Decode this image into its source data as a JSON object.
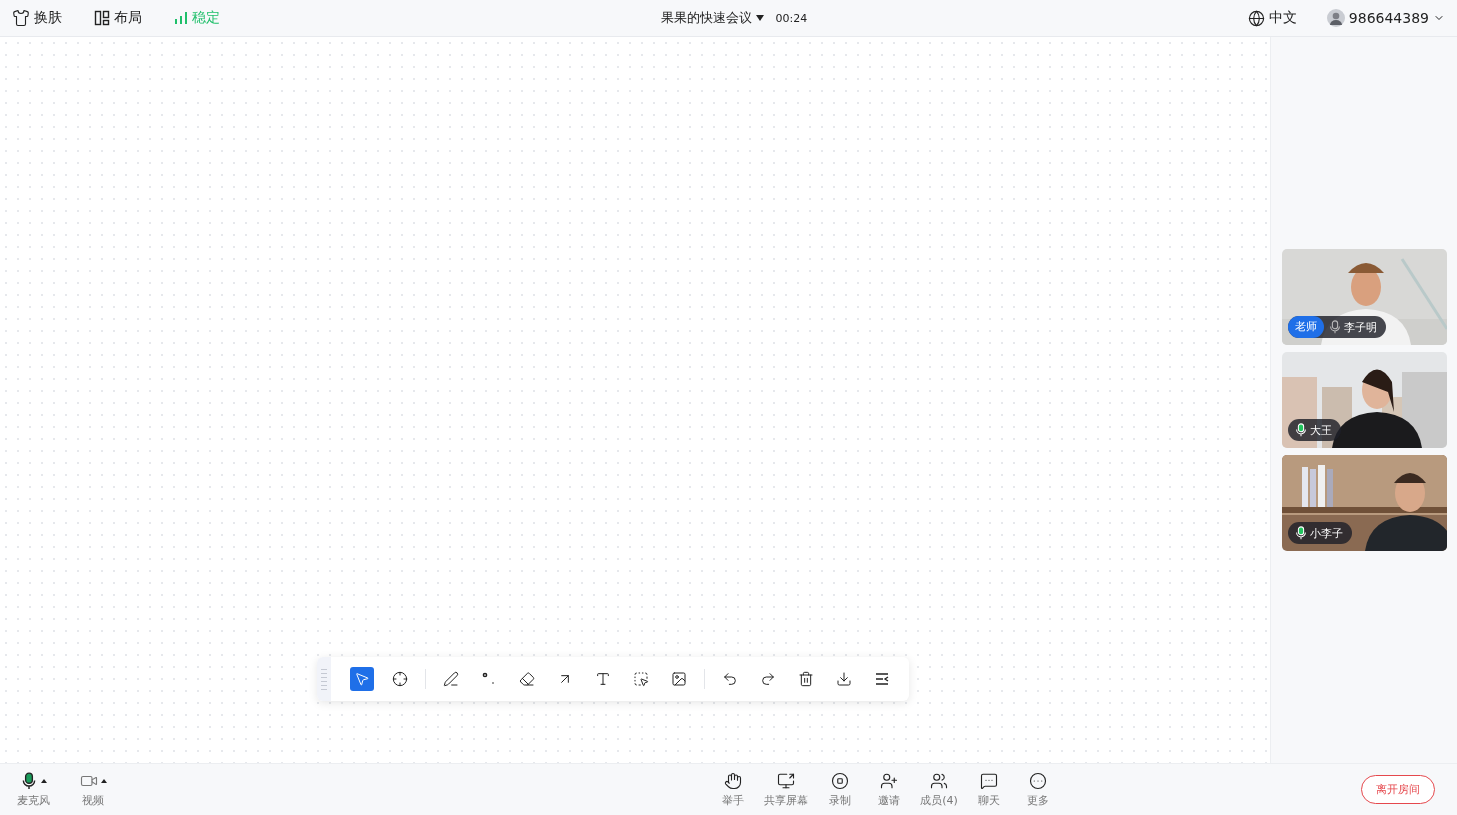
{
  "header": {
    "left": [
      {
        "kind": "skin",
        "label": "换肤"
      },
      {
        "kind": "layout",
        "label": "布局"
      },
      {
        "kind": "network",
        "label": "稳定",
        "color": "#1fbf6a"
      }
    ],
    "meeting": {
      "title": "果果的快速会议",
      "time": "00:24"
    },
    "language": "中文",
    "user": "986644389"
  },
  "participants": [
    {
      "name": "李子明",
      "role": "老师",
      "speaking": false
    },
    {
      "name": "大王",
      "speaking": true
    },
    {
      "name": "小李子",
      "speaking": true
    }
  ],
  "whiteboard_toolbar": {
    "groups": [
      {
        "tools": [
          {
            "selected": true
          },
          {
            "selected": false
          }
        ]
      },
      {
        "tools": [
          {
            "selected": false
          },
          {
            "selected": false
          },
          {
            "selected": false
          },
          {
            "selected": false
          },
          {
            "selected": false
          },
          {
            "selected": false
          },
          {
            "selected": false
          }
        ]
      },
      {
        "tools": [
          {
            "selected": false
          },
          {
            "selected": false
          },
          {
            "selected": false
          },
          {
            "selected": false
          },
          {
            "selected": false
          }
        ]
      }
    ]
  },
  "bottom_bar": {
    "left": [
      {
        "label": "麦克风",
        "on": true
      },
      {
        "label": "视频",
        "on": false
      }
    ],
    "center": [
      {
        "label": "举手"
      },
      {
        "label": "共享屏幕"
      },
      {
        "label": "录制"
      },
      {
        "label": "邀请"
      },
      {
        "label": "成员(4)"
      },
      {
        "label": "聊天"
      },
      {
        "label": "更多"
      }
    ],
    "leave": "离开房间"
  }
}
